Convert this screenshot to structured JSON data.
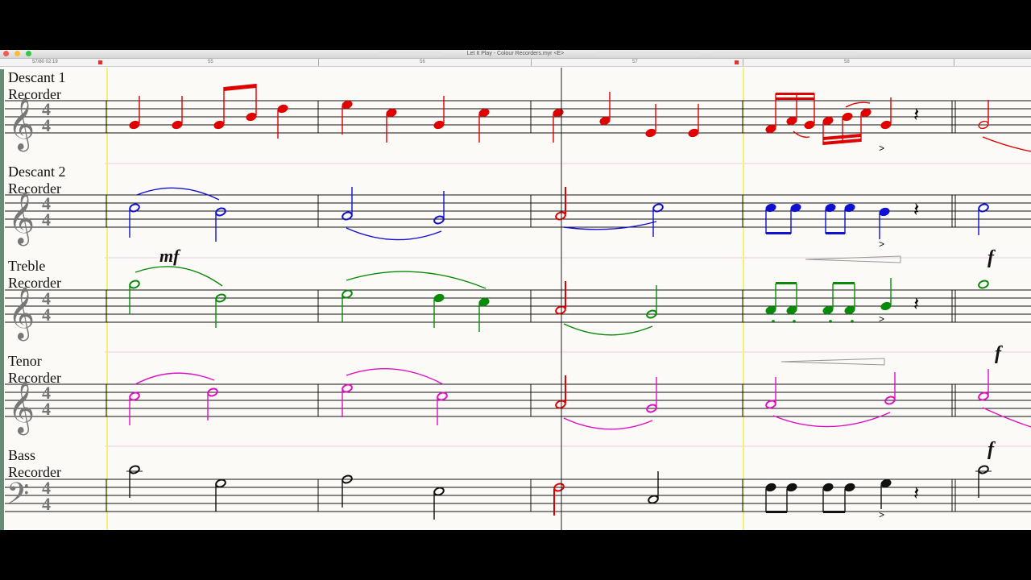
{
  "window": {
    "title": "Let It Play - Colour Recorders.myr <E>",
    "position_readout": "57/80 02:19",
    "bar_numbers": [
      "55",
      "56",
      "57",
      "58"
    ]
  },
  "staves": [
    {
      "name_line1": "Descant 1",
      "name_line2": "Recorder",
      "clef": "treble",
      "time_signature": "4/4",
      "color": "#e00000"
    },
    {
      "name_line1": "Descant 2",
      "name_line2": "Recorder",
      "clef": "treble",
      "time_signature": "4/4",
      "color": "#1010d0"
    },
    {
      "name_line1": "Treble",
      "name_line2": "Recorder",
      "clef": "treble",
      "time_signature": "4/4",
      "color": "#0a8a0a"
    },
    {
      "name_line1": "Tenor",
      "name_line2": "Recorder",
      "clef": "treble",
      "time_signature": "4/4",
      "color": "#e010c0"
    },
    {
      "name_line1": "Bass",
      "name_line2": "Recorder",
      "clef": "bass",
      "time_signature": "4/4",
      "color": "#000000"
    }
  ],
  "dynamics": {
    "treble_mf": "mf",
    "treble_f": "f",
    "tenor_f": "f",
    "bass_f": "f"
  },
  "glyphs": {
    "treble_clef": "𝄞",
    "bass_clef": "𝄢",
    "quarter_rest": "𝄽",
    "time_top": "4",
    "time_bottom": "4",
    "accent": ">"
  },
  "colors": {
    "playhead": "#222222",
    "loop_marker": "#f5f07a",
    "staff_line": "#111111",
    "separator": "#f2c8e8"
  }
}
